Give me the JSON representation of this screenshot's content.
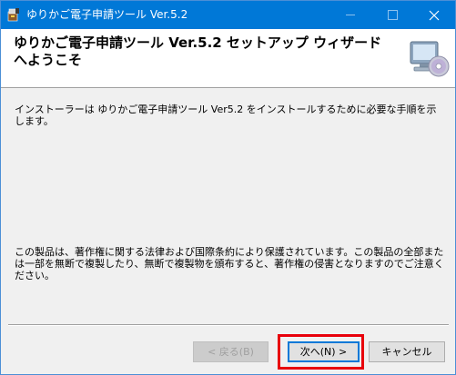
{
  "window": {
    "title": "ゆりかご電子申請ツール Ver.5.2"
  },
  "header": {
    "title": "ゆりかご電子申請ツール Ver.5.2 セットアップ ウィザードへようこそ",
    "image": "setup-computer-cd-icon"
  },
  "body": {
    "intro": "インストーラーは ゆりかご電子申請ツール Ver5.2 をインストールするために必要な手順を示します。",
    "copyright": "この製品は、著作権に関する法律および国際条約により保護されています。この製品の全部または一部を無断で複製したり、無断で複製物を頒布すると、著作権の侵害となりますのでご注意ください。"
  },
  "buttons": {
    "back": "< 戻る(B)",
    "next": "次へ(N) >",
    "cancel": "キャンセル"
  },
  "icons": {
    "app": "installer-icon",
    "minimize": "minimize-icon",
    "maximize": "maximize-icon",
    "close": "close-icon"
  },
  "colors": {
    "titlebar": "#0078d7",
    "highlight": "#e8000b",
    "dialog_bg": "#f0f0f0"
  }
}
